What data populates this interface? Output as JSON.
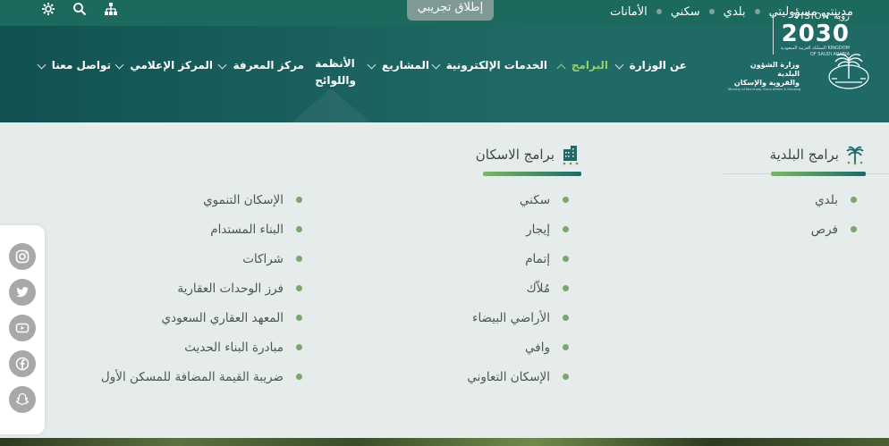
{
  "topbar": {
    "links": [
      "مدينتي مسؤوليتي",
      "بلدي",
      "سكني",
      "الأمانات"
    ],
    "beta_label": "إطلاق تجريبي",
    "icons": [
      "settings-icon",
      "search-icon",
      "sitemap-icon"
    ]
  },
  "logo": {
    "vision_label": "VISION رؤية",
    "vision_year": "2030",
    "vision_sub": "المملكة العربية السعودية KINGDOM OF SAUDI ARABIA",
    "ministry_ar_1": "وزارة الشؤون البلدية",
    "ministry_ar_2": "والقروية والإسكان",
    "ministry_en": "Ministry of Municipal, Rural Affairs & Housing"
  },
  "nav": {
    "items": [
      {
        "label": "عن الوزارة",
        "has_menu": true
      },
      {
        "label": "البرامج",
        "has_menu": true,
        "active": true
      },
      {
        "label": "الخدمات الإلكترونية",
        "has_menu": true
      },
      {
        "label": "المشاريع",
        "has_menu": true
      },
      {
        "label_1": "الأنظمة",
        "label_2": "واللوائح",
        "has_menu": false
      },
      {
        "label": "مركز المعرفة",
        "has_menu": true
      },
      {
        "label": "المركز الإعلامي",
        "has_menu": true
      },
      {
        "label": "تواصل معنا",
        "has_menu": true
      }
    ]
  },
  "programs_menu": {
    "municipal": {
      "title": "برامج البلدية",
      "items": [
        "بلدي",
        "فرص"
      ]
    },
    "housing": {
      "title": "برامج الاسكان",
      "items_col1": [
        "سكني",
        "إيجار",
        "إتمام",
        "مُلاّك",
        "الأراضي البيضاء",
        "وافي",
        "الإسكان التعاوني"
      ],
      "items_col2": [
        "الإسكان التنموي",
        "البناء المستدام",
        "شراكات",
        "فرز الوحدات العقارية",
        "المعهد العقاري السعودي",
        "مبادرة البناء الحديث",
        "ضريبة القيمة المضافة للمسكن الأول"
      ]
    }
  },
  "social": [
    "instagram-icon",
    "twitter-icon",
    "youtube-icon",
    "facebook-icon",
    "snapchat-icon"
  ],
  "colors": {
    "topbar": "#1c6a5e",
    "header": "#1f6a66",
    "accent_green": "#97cf6d",
    "bullet": "#79a86a"
  }
}
